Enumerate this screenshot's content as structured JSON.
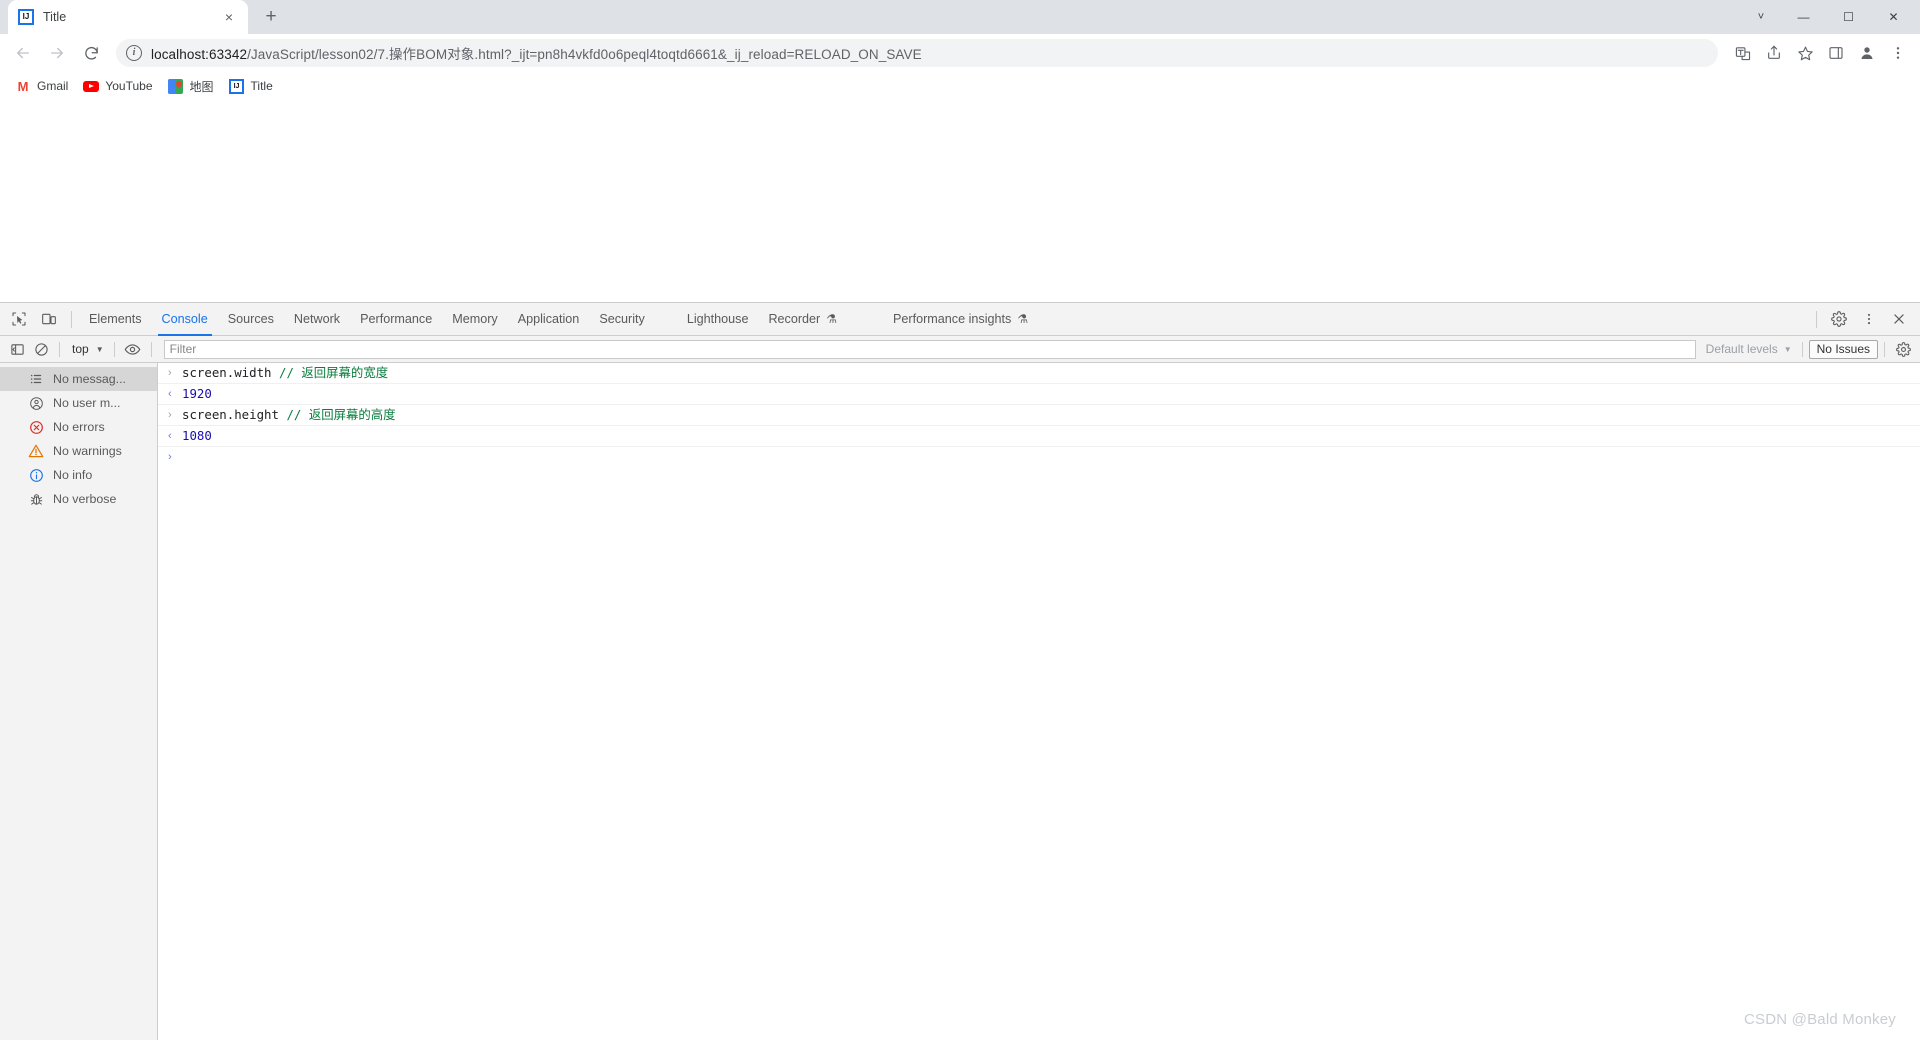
{
  "window": {
    "tab": {
      "title": "Title",
      "favicon": "intellij-idea-icon",
      "close": "×"
    },
    "new_tab_label": "+",
    "controls": {
      "caret": "˅",
      "minimize": "—",
      "maximize": "☐",
      "close": "✕"
    }
  },
  "toolbar": {
    "back": "←",
    "forward": "→",
    "reload": "⟳",
    "url_full": "localhost:63342/JavaScript/lesson02/7.操作BOM对象.html?_ijt=pn8h4vkfd0o6peql4toqtd6661&_ij_reload=RELOAD_ON_SAVE",
    "url_host": "localhost:63342",
    "url_path": "/JavaScript/lesson02/7.操作BOM对象.html?_ijt=pn8h4vkfd0o6peql4toqtd6661&_ij_reload=RELOAD_ON_SAVE",
    "site_info": "ⓘ",
    "right_icons": [
      "translate-icon",
      "share-icon",
      "bookmark-star-icon",
      "side-panel-icon",
      "profile-icon",
      "chrome-menu-icon"
    ]
  },
  "bookmarks": [
    {
      "label": "Gmail",
      "icon": "gmail-icon"
    },
    {
      "label": "YouTube",
      "icon": "youtube-icon"
    },
    {
      "label": "地图",
      "icon": "google-maps-icon"
    },
    {
      "label": "Title",
      "icon": "intellij-idea-icon"
    }
  ],
  "devtools": {
    "inspect_icon": "inspect-element-icon",
    "device_icon": "device-toolbar-icon",
    "tabs": [
      {
        "label": "Elements",
        "active": false,
        "flask": false
      },
      {
        "label": "Console",
        "active": true,
        "flask": false
      },
      {
        "label": "Sources",
        "active": false,
        "flask": false
      },
      {
        "label": "Network",
        "active": false,
        "flask": false
      },
      {
        "label": "Performance",
        "active": false,
        "flask": false
      },
      {
        "label": "Memory",
        "active": false,
        "flask": false
      },
      {
        "label": "Application",
        "active": false,
        "flask": false
      },
      {
        "label": "Security",
        "active": false,
        "flask": false
      },
      {
        "label": "Lighthouse",
        "active": false,
        "flask": false
      },
      {
        "label": "Recorder",
        "active": false,
        "flask": true
      },
      {
        "label": "Performance insights",
        "active": false,
        "flask": true
      }
    ],
    "flask_glyph": "⚗",
    "right_icons": [
      "settings-gear-icon",
      "more-options-icon",
      "close-devtools-icon"
    ],
    "filterbar": {
      "sidebar_toggle": "console-sidebar-toggle-icon",
      "clear": "clear-console-icon",
      "context": "top",
      "context_caret": "▼",
      "eye": "live-expression-icon",
      "filter_placeholder": "Filter",
      "filter_value": "",
      "levels_label": "Default levels",
      "levels_caret": "▼",
      "issues_label": "No Issues",
      "settings": "console-settings-icon"
    },
    "sidebar": [
      {
        "label": "No messag...",
        "icon": "list-icon",
        "selected": true
      },
      {
        "label": "No user m...",
        "icon": "user-message-icon",
        "selected": false
      },
      {
        "label": "No errors",
        "icon": "error-icon",
        "selected": false
      },
      {
        "label": "No warnings",
        "icon": "warning-icon",
        "selected": false
      },
      {
        "label": "No info",
        "icon": "info-icon",
        "selected": false
      },
      {
        "label": "No verbose",
        "icon": "verbose-bug-icon",
        "selected": false
      }
    ],
    "console_rows": [
      {
        "kind": "input",
        "arrow": "›",
        "code": "screen.width ",
        "comment": "// 返回屏幕的宽度"
      },
      {
        "kind": "output",
        "arrow": "‹",
        "value": "1920"
      },
      {
        "kind": "input",
        "arrow": "›",
        "code": "screen.height ",
        "comment": "// 返回屏幕的高度"
      },
      {
        "kind": "output",
        "arrow": "‹",
        "value": "1080"
      },
      {
        "kind": "prompt",
        "arrow": "›",
        "code": "",
        "comment": ""
      }
    ]
  },
  "watermark": "CSDN @Bald Monkey",
  "colors": {
    "accent": "#1a73e8",
    "tabstrip_bg": "#dee1e6",
    "devtools_bg": "#f3f3f3",
    "comment_green": "#0b7d3e",
    "value_blue": "#1a0dab",
    "error_red": "#d93025",
    "warning_orange": "#e37400"
  }
}
